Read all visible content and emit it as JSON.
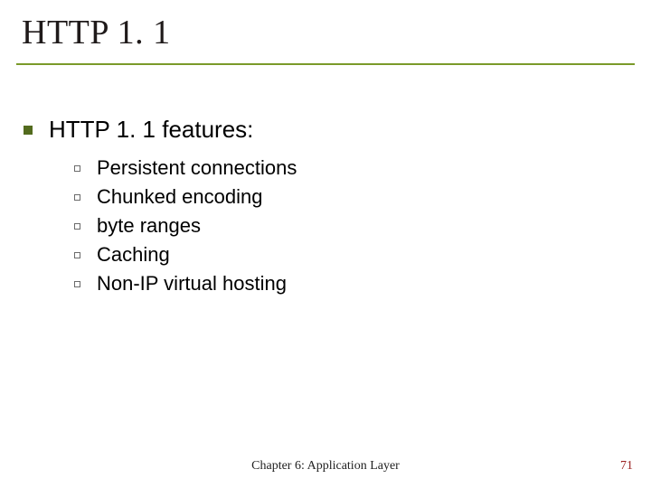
{
  "title": "HTTP 1. 1",
  "body": {
    "heading": "HTTP 1. 1 features:",
    "items": [
      "Persistent connections",
      "Chunked encoding",
      "byte ranges",
      "Caching",
      "Non-IP virtual hosting"
    ]
  },
  "footer": {
    "center": "Chapter 6: Application Layer",
    "page": "71"
  }
}
